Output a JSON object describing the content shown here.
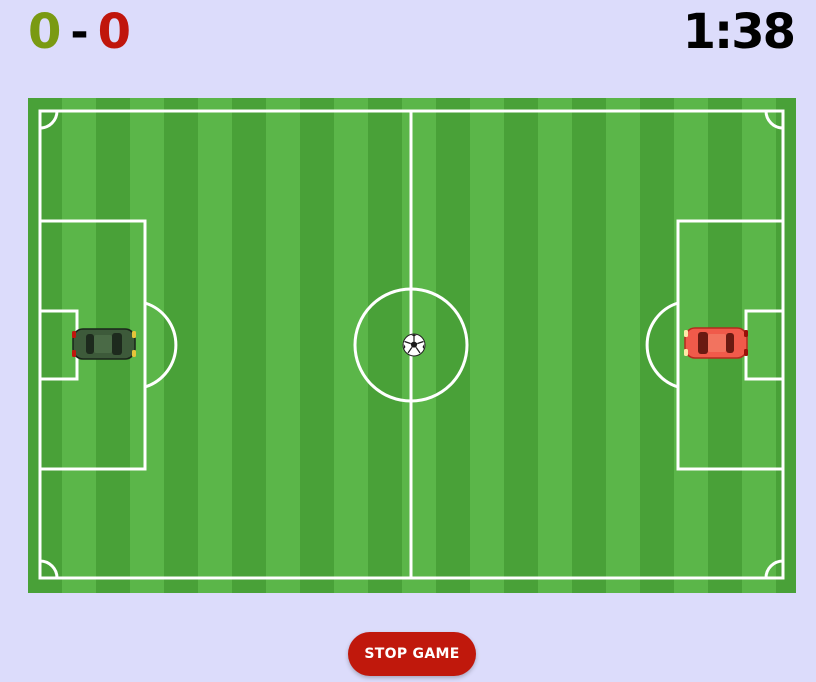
{
  "score": {
    "left": "0",
    "separator": "-",
    "right": "0",
    "left_color": "#7a9a12",
    "right_color": "#c0160c"
  },
  "timer": "1:38",
  "field": {
    "grass_color": "green-striped",
    "line_color": "#ffffff"
  },
  "players": [
    {
      "name": "left-car",
      "color": "#3d5a3a"
    },
    {
      "name": "right-car",
      "color": "#f05a4a"
    }
  ],
  "ball": {
    "icon": "soccer-ball-icon"
  },
  "controls": {
    "stop_label": "STOP GAME",
    "stop_color": "#c0180c"
  }
}
